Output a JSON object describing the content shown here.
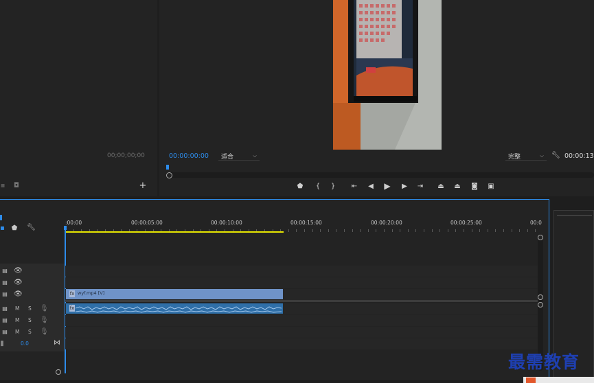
{
  "source_panel": {
    "timecode": "00;00;00;00",
    "icons": [
      "camera-icon",
      "add-icon"
    ]
  },
  "program_monitor": {
    "timecode": "00:00:00:00",
    "zoom": "适合",
    "quality": "完整",
    "duration": "00:00:13:",
    "transport": [
      "marker-icon",
      "mark-in-icon",
      "mark-out-icon",
      "go-to-in-icon",
      "step-back-icon",
      "play-icon",
      "step-forward-icon",
      "go-to-out-icon",
      "lift-icon",
      "extract-icon",
      "export-frame-icon",
      "compare-icon"
    ]
  },
  "timeline": {
    "ruler_labels": [
      ":00:00",
      "00:00:05:00",
      "00:00:10:00",
      "00:00:15:00",
      "00:00:20:00",
      "00:00:25:00",
      "00:0"
    ],
    "video_tracks": 3,
    "audio_tracks": [
      {
        "m": "M",
        "s": "S"
      },
      {
        "m": "M",
        "s": "S"
      },
      {
        "m": "M",
        "s": "S"
      }
    ],
    "master_value": "0.0",
    "clip_label": "wyf.mp4 [V]"
  },
  "watermark": {
    "text": "最需教育"
  },
  "colors": {
    "accent_blue": "#2d8ceb",
    "work_area": "#e6e600",
    "video_clip": "#6f93c8",
    "audio_clip": "#2f6fa8",
    "watermark": "#1e3fb0"
  }
}
